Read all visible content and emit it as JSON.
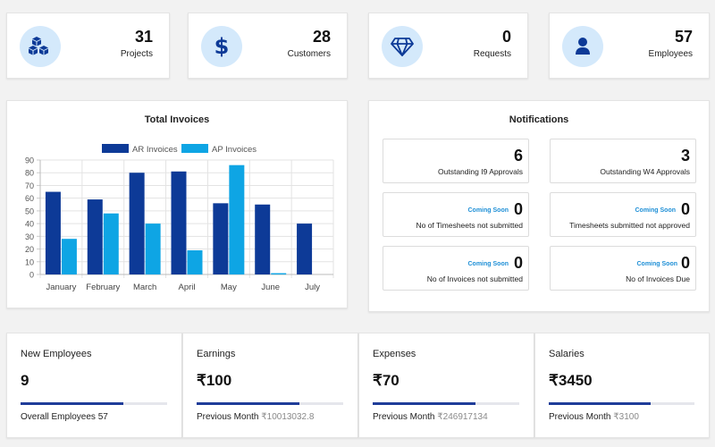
{
  "stats": [
    {
      "value": "31",
      "label": "Projects",
      "icon": "cubes-icon"
    },
    {
      "value": "28",
      "label": "Customers",
      "icon": "dollar-icon"
    },
    {
      "value": "0",
      "label": "Requests",
      "icon": "diamond-icon"
    },
    {
      "value": "57",
      "label": "Employees",
      "icon": "user-icon"
    }
  ],
  "colors": {
    "accent": "#1f3d99",
    "ar": "#0d3a97",
    "ap": "#0ea5e4",
    "icon_bg": "#d4e9fb",
    "icon_fg": "#0d3a97",
    "soon": "#1e8fd6"
  },
  "chart_data": {
    "type": "bar",
    "title": "Total Invoices",
    "categories": [
      "January",
      "February",
      "March",
      "April",
      "May",
      "June",
      "July"
    ],
    "series": [
      {
        "name": "AR Invoices",
        "values": [
          65,
          59,
          80,
          81,
          56,
          55,
          40
        ]
      },
      {
        "name": "AP Invoices",
        "values": [
          28,
          48,
          40,
          19,
          86,
          1,
          null
        ]
      }
    ],
    "yticks": [
      0,
      10,
      20,
      30,
      40,
      50,
      60,
      70,
      80,
      90
    ],
    "ylim": [
      0,
      90
    ],
    "legend": "top",
    "grid": true
  },
  "notifications": {
    "title": "Notifications",
    "items": [
      {
        "value": "6",
        "label": "Outstanding I9 Approvals",
        "badge": ""
      },
      {
        "value": "3",
        "label": "Outstanding W4 Approvals",
        "badge": ""
      },
      {
        "value": "0",
        "label": "No of Timesheets not submitted",
        "badge": "Coming Soon"
      },
      {
        "value": "0",
        "label": "Timesheets submitted not approved",
        "badge": "Coming Soon"
      },
      {
        "value": "0",
        "label": "No of Invoices not submitted",
        "badge": "Coming Soon"
      },
      {
        "value": "0",
        "label": "No of Invoices Due",
        "badge": "Coming Soon"
      }
    ]
  },
  "metrics": [
    {
      "title": "New Employees",
      "value": "9",
      "progress": 0.7,
      "foot_label": "Overall Employees 57",
      "foot_value": ""
    },
    {
      "title": "Earnings",
      "value": "₹100",
      "progress": 0.7,
      "foot_label": "Previous Month",
      "foot_value": "₹10013032.8"
    },
    {
      "title": "Expenses",
      "value": "₹70",
      "progress": 0.7,
      "foot_label": "Previous Month",
      "foot_value": "₹246917134"
    },
    {
      "title": "Salaries",
      "value": "₹3450",
      "progress": 0.7,
      "foot_label": "Previous Month",
      "foot_value": "₹3100"
    }
  ]
}
